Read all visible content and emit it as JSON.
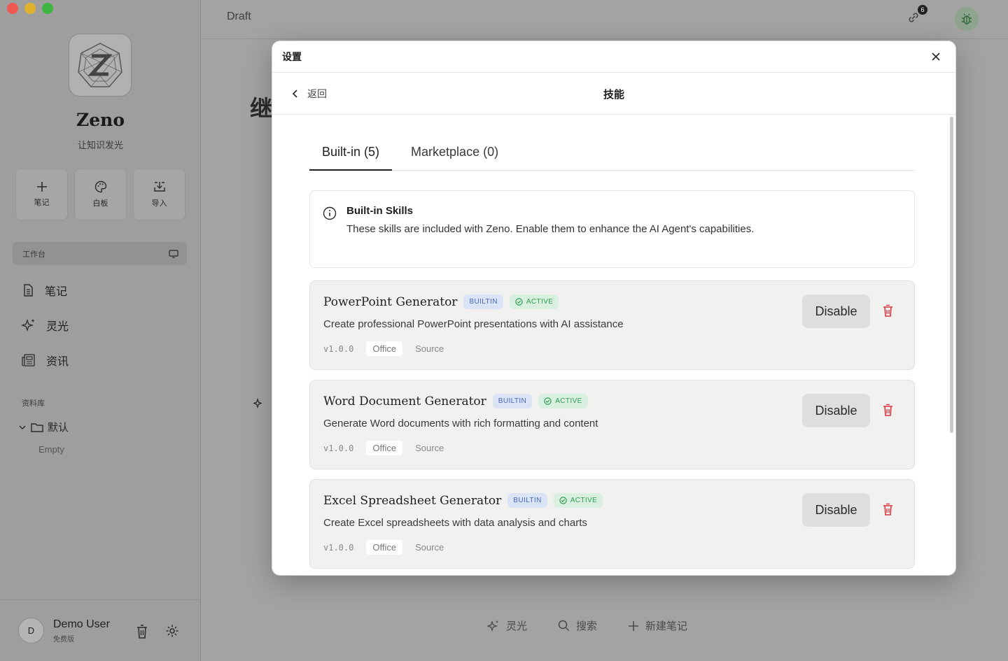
{
  "sidebar": {
    "brand": "Zeno",
    "tagline": "让知识发光",
    "quick_actions": [
      {
        "label": "笔记",
        "icon": "plus-icon"
      },
      {
        "label": "白板",
        "icon": "palette-icon"
      },
      {
        "label": "导入",
        "icon": "import-icon"
      }
    ],
    "workbench_label": "工作台",
    "nav": [
      {
        "label": "笔记",
        "icon": "document-icon"
      },
      {
        "label": "灵光",
        "icon": "sparkle-icon"
      },
      {
        "label": "资讯",
        "icon": "news-icon"
      }
    ],
    "library_label": "资料库",
    "folder_name": "默认",
    "folder_empty": "Empty",
    "user": {
      "initial": "D",
      "name": "Demo User",
      "plan": "免费版"
    }
  },
  "main": {
    "draft_label": "Draft",
    "link_badge": "6",
    "bg_title": "继",
    "bottom_bar": [
      {
        "label": "灵光",
        "icon": "sparkle-icon"
      },
      {
        "label": "搜索",
        "icon": "search-icon"
      },
      {
        "label": "新建笔记",
        "icon": "plus-icon"
      }
    ]
  },
  "modal": {
    "title": "设置",
    "back_label": "返回",
    "page_title": "技能",
    "tabs": [
      {
        "label": "Built-in (5)",
        "active": true
      },
      {
        "label": "Marketplace (0)",
        "active": false
      }
    ],
    "info": {
      "title": "Built-in Skills",
      "text": "These skills are included with Zeno. Enable them to enhance the AI Agent's capabilities."
    },
    "skills": [
      {
        "name": "PowerPoint Generator",
        "builtin_tag": "BUILTIN",
        "status_tag": "ACTIVE",
        "description": "Create professional PowerPoint presentations with AI assistance",
        "version": "v1.0.0",
        "category": "Office",
        "source_label": "Source",
        "action_label": "Disable"
      },
      {
        "name": "Word Document Generator",
        "builtin_tag": "BUILTIN",
        "status_tag": "ACTIVE",
        "description": "Generate Word documents with rich formatting and content",
        "version": "v1.0.0",
        "category": "Office",
        "source_label": "Source",
        "action_label": "Disable"
      },
      {
        "name": "Excel Spreadsheet Generator",
        "builtin_tag": "BUILTIN",
        "status_tag": "ACTIVE",
        "description": "Create Excel spreadsheets with data analysis and charts",
        "version": "v1.0.0",
        "category": "Office",
        "source_label": "Source",
        "action_label": "Disable"
      }
    ]
  },
  "colors": {
    "builtin_bg": "#dbe4f6",
    "builtin_text": "#4667b8",
    "active_bg": "#d9efdf",
    "active_text": "#2e9c4e",
    "danger": "#d9363e"
  }
}
